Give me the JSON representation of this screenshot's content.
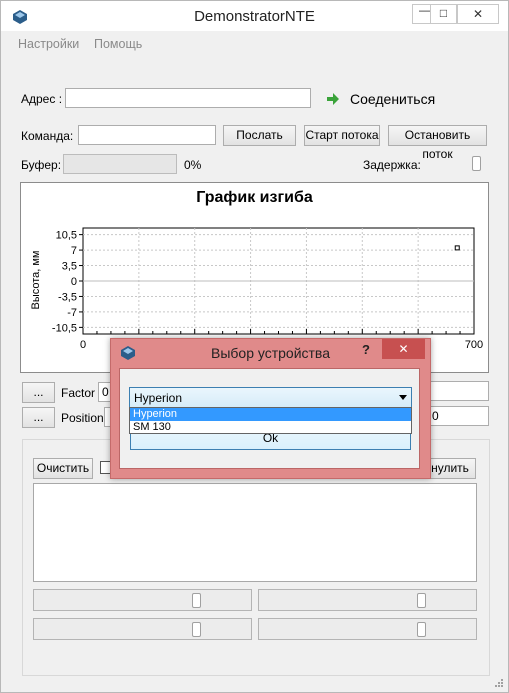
{
  "window": {
    "title": "DemonstratorNTE",
    "minimize": "—",
    "maximize": "□",
    "close": "✕"
  },
  "menu": {
    "settings": "Настройки",
    "help": "Помощь"
  },
  "address": {
    "label": "Адрес :",
    "value": "",
    "connect_label": "Соедениться",
    "connect_icon": "green-arrow-icon"
  },
  "command": {
    "label": "Команда:",
    "value": "",
    "send": "Послать",
    "start_stream": "Старт потока",
    "stop_stream": "Остановить поток"
  },
  "buffer": {
    "label": "Буфер:",
    "progress": 0,
    "percent": "0%",
    "delay_label": "Задержка:"
  },
  "chart_data": {
    "type": "scatter",
    "title": "График изгиба",
    "ylabel": "Высота, мм",
    "xlabel": "",
    "xlim": [
      0,
      700
    ],
    "ylim": [
      -12,
      12
    ],
    "yticks": [
      "10,5",
      "7",
      "3,5",
      "0",
      "-3,5",
      "-7",
      "-10,5"
    ],
    "ytick_values": [
      10.5,
      7,
      3.5,
      0,
      -3.5,
      -7,
      -10.5
    ],
    "xticks": [
      "0",
      "700"
    ],
    "xtick_values": [
      0,
      700
    ],
    "grid": true,
    "series": [
      {
        "x": [
          670
        ],
        "y": [
          7.5
        ]
      }
    ]
  },
  "factor": {
    "browse": "...",
    "label": "Factor",
    "value": "0",
    "right_value": ""
  },
  "position": {
    "browse": "...",
    "label": "Position",
    "value": "",
    "right_value": "0"
  },
  "bottom": {
    "clear": "Очистить",
    "zero": "нулить",
    "log": ""
  },
  "dialog": {
    "title": "Выбор устройства",
    "help": "?",
    "close": "✕",
    "selected": "Hyperion",
    "options": [
      "Hyperion",
      "SM 130"
    ],
    "ok": "Ok"
  }
}
